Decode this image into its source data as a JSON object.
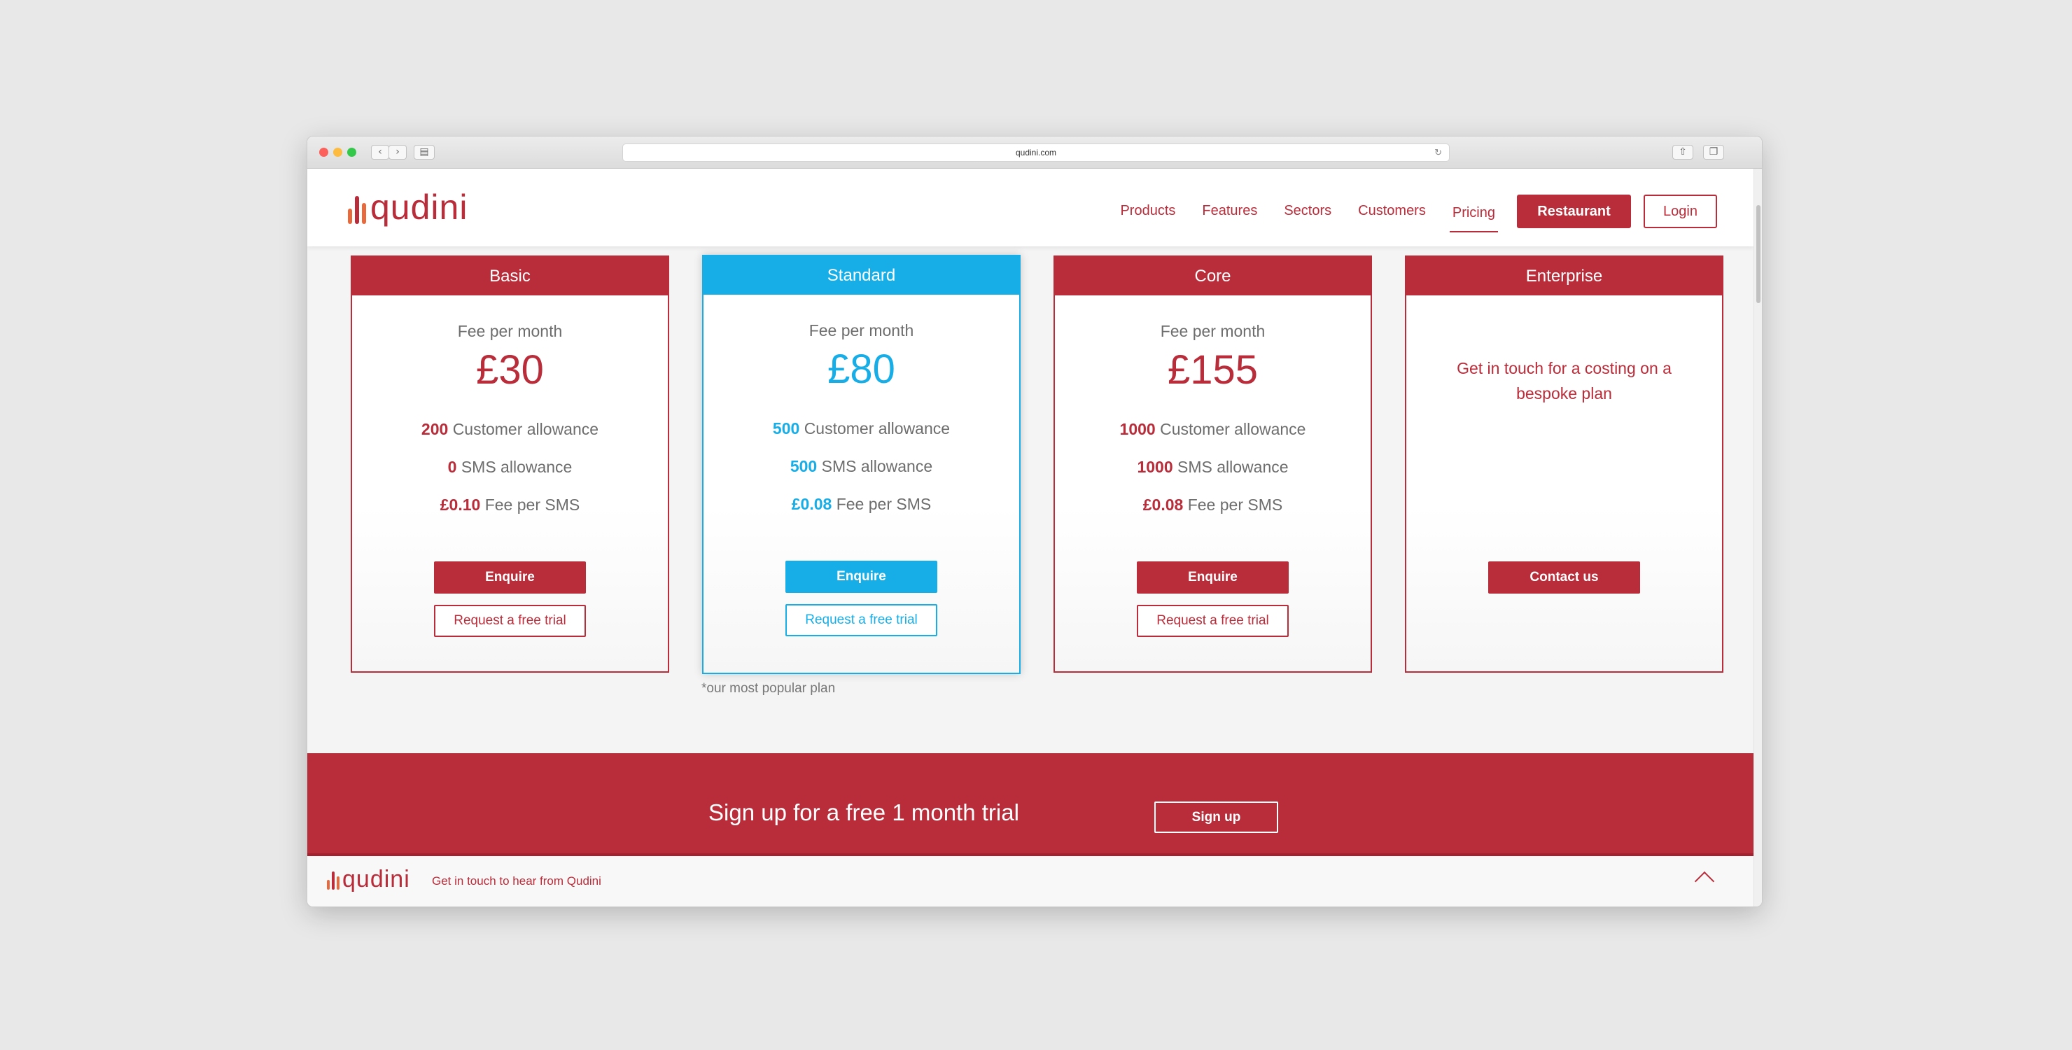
{
  "browser": {
    "url": "qudini.com",
    "back_icon": "chevron-left-icon",
    "forward_icon": "chevron-right-icon",
    "sidebar_icon": "sidebar-icon",
    "share_icon": "share-icon",
    "tabs_icon": "tabs-icon",
    "reload_icon": "reload-icon"
  },
  "brand": {
    "logo_text": "qudini",
    "primary_color": "#b92c39",
    "accent_color": "#17aee8"
  },
  "nav": {
    "items": [
      "Products",
      "Features",
      "Sectors",
      "Customers",
      "Pricing"
    ],
    "active": "Pricing",
    "restaurant_label": "Restaurant",
    "login_label": "Login"
  },
  "plans": [
    {
      "name": "Basic",
      "fee_label": "Fee per month",
      "price": "£30",
      "features": [
        {
          "value": "200",
          "label": "Customer allowance"
        },
        {
          "value": "0",
          "label": "SMS allowance"
        },
        {
          "value": "£0.10",
          "label": "Fee per SMS"
        }
      ],
      "primary_button": "Enquire",
      "secondary_button": "Request a free trial"
    },
    {
      "name": "Standard",
      "fee_label": "Fee per month",
      "price": "£80",
      "features": [
        {
          "value": "500",
          "label": "Customer allowance"
        },
        {
          "value": "500",
          "label": "SMS allowance"
        },
        {
          "value": "£0.08",
          "label": "Fee per SMS"
        }
      ],
      "primary_button": "Enquire",
      "secondary_button": "Request a free trial",
      "highlight": true
    },
    {
      "name": "Core",
      "fee_label": "Fee per month",
      "price": "£155",
      "features": [
        {
          "value": "1000",
          "label": "Customer allowance"
        },
        {
          "value": "1000",
          "label": "SMS allowance"
        },
        {
          "value": "£0.08",
          "label": "Fee per SMS"
        }
      ],
      "primary_button": "Enquire",
      "secondary_button": "Request a free trial"
    },
    {
      "name": "Enterprise",
      "description": "Get in touch for a costing on a bespoke plan",
      "primary_button": "Contact us"
    }
  ],
  "popular_note": "*our most popular plan",
  "signup": {
    "text": "Sign up for a free 1 month trial",
    "button": "Sign up"
  },
  "footer": {
    "logo_text": "qudini",
    "text": "Get in touch to hear from Qudini",
    "toggle_icon": "chevron-up-icon"
  }
}
